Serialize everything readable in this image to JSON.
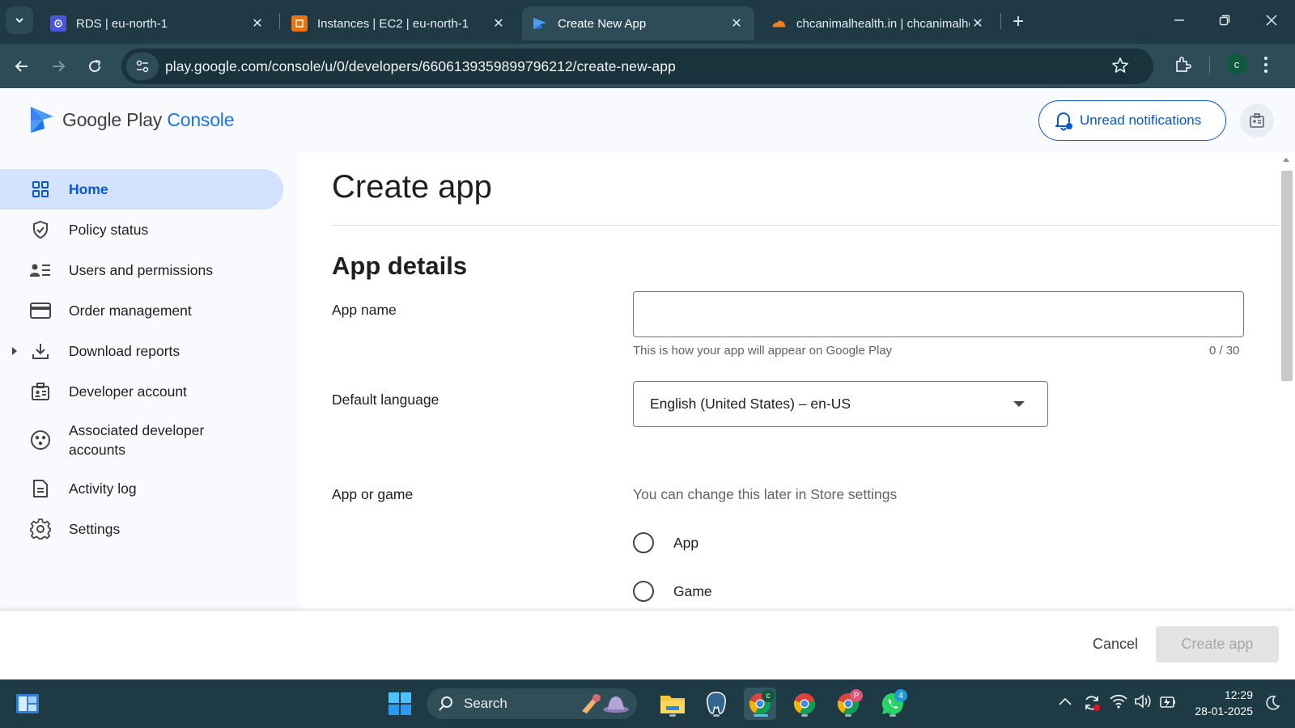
{
  "browser": {
    "tabs": [
      {
        "title": "RDS | eu-north-1",
        "active": false,
        "favicon": "aws-rds-icon"
      },
      {
        "title": "Instances | EC2 | eu-north-1",
        "active": false,
        "favicon": "aws-ec2-icon"
      },
      {
        "title": "Create New App",
        "active": true,
        "favicon": "play-console-icon"
      },
      {
        "title": "chcanimalhealth.in | chcanimalhealth",
        "active": false,
        "favicon": "cloudflare-icon"
      }
    ],
    "url": "play.google.com/console/u/0/developers/6606139359899796212/create-new-app",
    "profile_initial": "c"
  },
  "header": {
    "logo_text": "Google Play",
    "logo_accent": "Console",
    "notifications_label": "Unread notifications"
  },
  "sidebar": {
    "items": [
      {
        "label": "Home",
        "icon": "dashboard-grid-icon",
        "active": true
      },
      {
        "label": "Policy status",
        "icon": "shield-check-icon"
      },
      {
        "label": "Users and permissions",
        "icon": "users-list-icon"
      },
      {
        "label": "Order management",
        "icon": "credit-card-icon"
      },
      {
        "label": "Download reports",
        "icon": "download-icon",
        "expandable": true
      },
      {
        "label": "Developer account",
        "icon": "id-badge-icon"
      },
      {
        "label": "Associated developer accounts",
        "icon": "linked-accounts-icon"
      },
      {
        "label": "Activity log",
        "icon": "document-icon"
      },
      {
        "label": "Settings",
        "icon": "gear-icon"
      }
    ]
  },
  "main": {
    "page_title": "Create app",
    "section_title": "App details",
    "app_name": {
      "label": "App name",
      "value": "",
      "hint": "This is how your app will appear on Google Play",
      "counter": "0 / 30"
    },
    "default_language": {
      "label": "Default language",
      "value": "English (United States) – en-US"
    },
    "app_or_game": {
      "label": "App or game",
      "hint": "You can change this later in Store settings",
      "options": [
        "App",
        "Game"
      ]
    }
  },
  "footer": {
    "cancel_label": "Cancel",
    "create_label": "Create app"
  },
  "taskbar": {
    "search_label": "Search",
    "time": "12:29",
    "date": "28-01-2025",
    "whatsapp_badge": "4",
    "chrome_profile_c_badge": "c",
    "chrome_profile_p_badge": "P"
  },
  "colors": {
    "accent": "#0b57d0",
    "active_nav_bg": "#d3e3fd",
    "chrome_dark": "#1f3a44"
  }
}
